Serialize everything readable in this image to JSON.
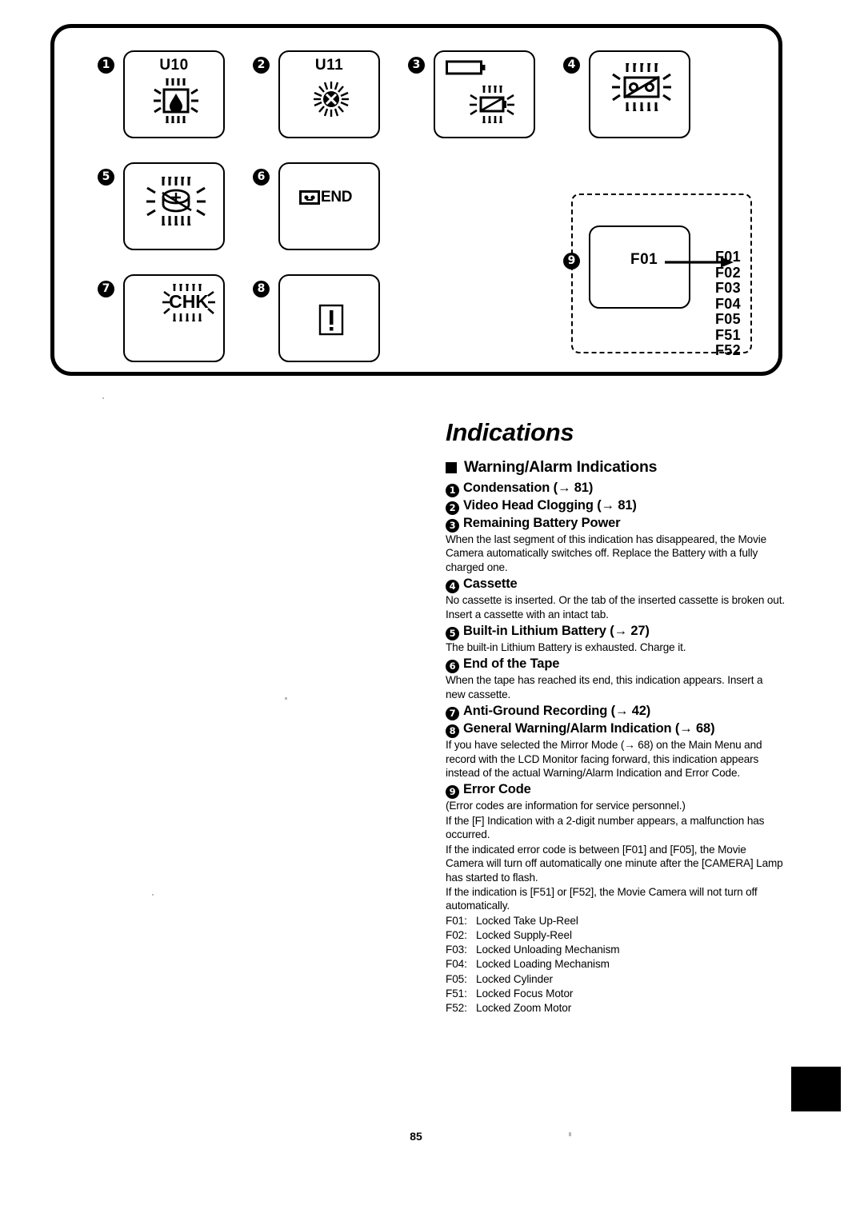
{
  "page": {
    "number": "85",
    "title": "Indications"
  },
  "diagram": {
    "panels": [
      {
        "badge": "1",
        "name": "condensation-indication",
        "label": "U10",
        "icon": "water-drop-in-box-flashing-icon"
      },
      {
        "badge": "2",
        "name": "video-head-clogging-indication",
        "label": "U11",
        "icon": "sun-x-flashing-icon"
      },
      {
        "badge": "3",
        "name": "remaining-battery-power-indication",
        "label": "",
        "icon": "battery-empty-flashing-icon"
      },
      {
        "badge": "4",
        "name": "cassette-indication",
        "label": "",
        "icon": "cassette-crossed-flashing-icon"
      },
      {
        "badge": "5",
        "name": "built-in-lithium-battery-indication",
        "label": "",
        "icon": "coin-cell-crossed-flashing-icon"
      },
      {
        "badge": "6",
        "name": "end-of-tape-indication",
        "label": "END",
        "icon": "cassette-end-icon"
      },
      {
        "badge": "7",
        "name": "anti-ground-recording-indication",
        "label": "CHK",
        "icon": "chk-flashing-icon"
      },
      {
        "badge": "8",
        "name": "general-warning-alarm-indication",
        "label": "",
        "icon": "exclamation-box-icon"
      }
    ],
    "error_panel": {
      "badge": "9",
      "screen_code": "F01",
      "codes": [
        "F01",
        "F02",
        "F03",
        "F04",
        "F05",
        "F51",
        "F52"
      ]
    }
  },
  "content": {
    "section_heading": "Warning/Alarm Indications",
    "items": [
      {
        "badge": "1",
        "heading": "Condensation (→ 81)",
        "paragraphs": []
      },
      {
        "badge": "2",
        "heading": "Video Head Clogging (→ 81)",
        "paragraphs": []
      },
      {
        "badge": "3",
        "heading": "Remaining Battery Power",
        "paragraphs": [
          "When the last segment of this indication has disappeared, the Movie Camera automatically switches off. Replace the Battery with a fully charged one."
        ]
      },
      {
        "badge": "4",
        "heading": "Cassette",
        "paragraphs": [
          "No cassette is inserted. Or the tab of the inserted cassette is broken out. Insert a cassette with an intact tab."
        ]
      },
      {
        "badge": "5",
        "heading": "Built-in Lithium Battery (→ 27)",
        "paragraphs": [
          "The built-in Lithium Battery is exhausted. Charge it."
        ]
      },
      {
        "badge": "6",
        "heading": "End of the Tape",
        "paragraphs": [
          "When the tape has reached its end, this indication appears. Insert a new cassette."
        ]
      },
      {
        "badge": "7",
        "heading": "Anti-Ground Recording (→ 42)",
        "paragraphs": []
      },
      {
        "badge": "8",
        "heading": "General Warning/Alarm Indication (→ 68)",
        "paragraphs": [
          "If you have selected the Mirror Mode (→ 68) on the Main Menu and record with the LCD Monitor facing forward, this indication appears instead of the actual Warning/Alarm Indication and Error Code."
        ]
      },
      {
        "badge": "9",
        "heading": "Error Code",
        "paragraphs": [
          "(Error codes are information for service personnel.)",
          "If the [F] Indication with a 2-digit number appears, a malfunction has occurred.",
          "If the indicated error code is between [F01] and [F05], the Movie Camera will turn off automatically one minute after the [CAMERA] Lamp has started to flash.",
          "If the indication is [F51] or [F52], the Movie Camera will not turn off automatically."
        ]
      }
    ],
    "error_code_table": [
      {
        "code": "F01:",
        "desc": "Locked Take Up-Reel"
      },
      {
        "code": "F02:",
        "desc": "Locked Supply-Reel"
      },
      {
        "code": "F03:",
        "desc": "Locked Unloading Mechanism"
      },
      {
        "code": "F04:",
        "desc": "Locked Loading Mechanism"
      },
      {
        "code": "F05:",
        "desc": "Locked Cylinder"
      },
      {
        "code": "F51:",
        "desc": "Locked Focus Motor"
      },
      {
        "code": "F52:",
        "desc": "Locked Zoom Motor"
      }
    ]
  }
}
